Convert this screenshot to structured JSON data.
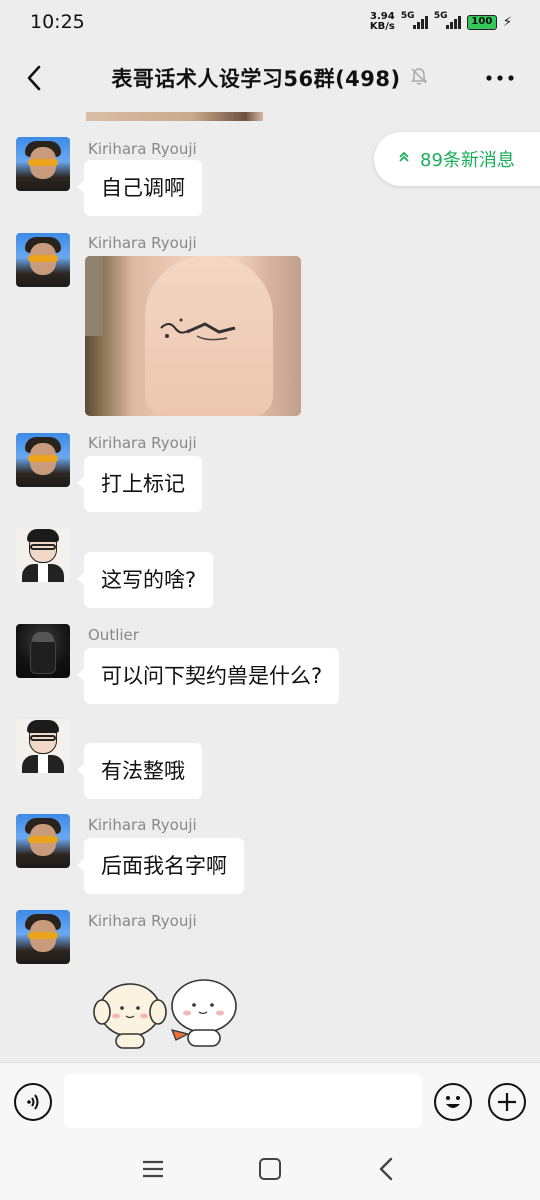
{
  "status_bar": {
    "time": "10:25",
    "net_speed_value": "3.94",
    "net_speed_unit": "KB/s",
    "sim1_label": "5G",
    "sim2_label": "5G",
    "battery_level": "100"
  },
  "header": {
    "title": "表哥话术人设学习56群(498)",
    "back_icon": "back-arrow-icon",
    "mute_icon": "bell-muted-icon",
    "more_icon": "more-dots-icon"
  },
  "new_messages_pill": {
    "label": "89条新消息",
    "icon": "double-chevron-up-icon",
    "color": "#1aad5a"
  },
  "messages": [
    {
      "sender": "Kirihara Ryouji",
      "avatar": "kirihara-avatar",
      "type": "text",
      "text": "自己调啊"
    },
    {
      "sender": "Kirihara Ryouji",
      "avatar": "kirihara-avatar",
      "type": "image",
      "text": ""
    },
    {
      "sender": "Kirihara Ryouji",
      "avatar": "kirihara-avatar",
      "type": "text",
      "text": "打上标记"
    },
    {
      "sender": "",
      "avatar": "cartoon-avatar",
      "type": "text",
      "text": "这写的啥?"
    },
    {
      "sender": "Outlier",
      "avatar": "outlier-avatar",
      "type": "text",
      "text": "可以问下契约兽是什么?"
    },
    {
      "sender": "",
      "avatar": "cartoon-avatar",
      "type": "text",
      "text": "有法整哦"
    },
    {
      "sender": "Kirihara Ryouji",
      "avatar": "kirihara-avatar",
      "type": "text",
      "text": "后面我名字啊"
    },
    {
      "sender": "Kirihara Ryouji",
      "avatar": "kirihara-avatar",
      "type": "sticker",
      "text": ""
    }
  ],
  "input_bar": {
    "placeholder": "",
    "voice_icon": "voice-icon",
    "emoji_icon": "emoji-icon",
    "plus_icon": "plus-icon"
  },
  "system_nav": {
    "menu_icon": "menu-icon",
    "home_icon": "home-icon",
    "back_icon": "back-icon"
  }
}
